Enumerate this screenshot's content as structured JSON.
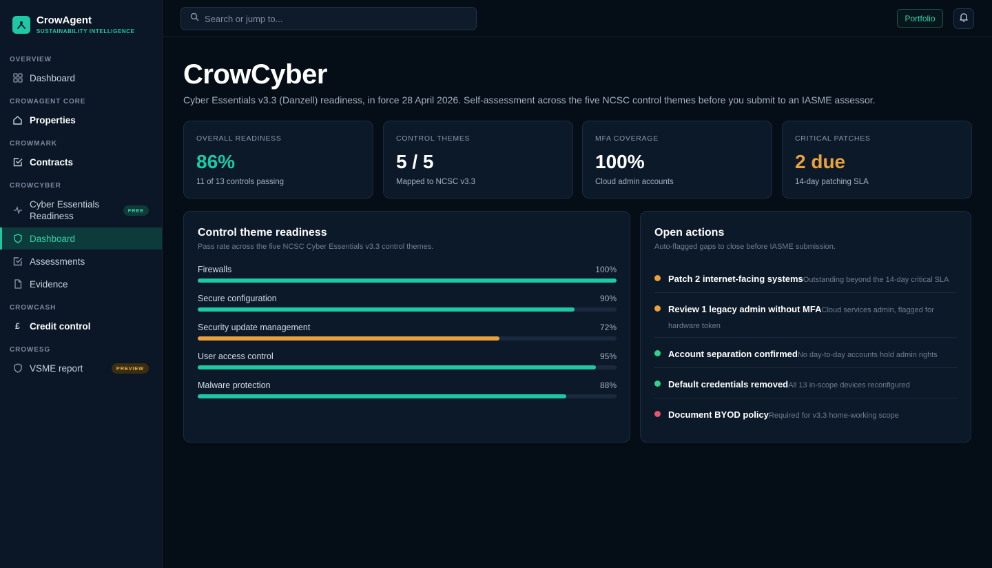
{
  "brand": {
    "name": "CrowAgent",
    "tagline": "SUSTAINABILITY INTELLIGENCE"
  },
  "sidebar": {
    "sections": [
      "OVERVIEW",
      "CROWAGENT CORE",
      "CROWMARK",
      "CROWCYBER",
      "CROWCASH",
      "CROWESG"
    ],
    "items": [
      {
        "label": "Dashboard",
        "icon": "grid-icon"
      },
      {
        "label": "Properties",
        "icon": "home-icon"
      },
      {
        "label": "Contracts",
        "icon": "checkbox-icon"
      },
      {
        "label": "Cyber Essentials Readiness",
        "icon": "sparkle-icon",
        "badge": "FREE"
      },
      {
        "label": "Dashboard",
        "icon": "shield-icon",
        "active": true
      },
      {
        "label": "Assessments",
        "icon": "checkbox-icon"
      },
      {
        "label": "Evidence",
        "icon": "document-icon"
      },
      {
        "label": "Credit control",
        "icon": "pound-icon",
        "glyph": "£"
      },
      {
        "label": "VSME report",
        "icon": "shield-icon",
        "badge": "PREVIEW"
      }
    ]
  },
  "topbar": {
    "search_placeholder": "Search or jump to...",
    "portfolio_label": "Portfolio"
  },
  "page": {
    "title": "CrowCyber",
    "subtitle": "Cyber Essentials v3.3 (Danzell) readiness, in force 28 April 2026. Self-assessment across the five NCSC control themes before you submit to an IASME assessor."
  },
  "kpis": [
    {
      "label": "OVERALL READINESS",
      "value": "86%",
      "sub": "11 of 13 controls passing",
      "color": "#1ec8a5"
    },
    {
      "label": "CONTROL THEMES",
      "value": "5 / 5",
      "sub": "Mapped to NCSC v3.3",
      "color": "#ffffff"
    },
    {
      "label": "MFA COVERAGE",
      "value": "100%",
      "sub": "Cloud admin accounts",
      "color": "#ffffff"
    },
    {
      "label": "CRITICAL PATCHES",
      "value": "2 due",
      "sub": "14-day patching SLA",
      "color": "#e9a23b"
    }
  ],
  "themes_panel": {
    "title": "Control theme readiness",
    "subtitle": "Pass rate across the five NCSC Cyber Essentials v3.3 control themes.",
    "rows": [
      {
        "label": "Firewalls",
        "value": "100%",
        "percent": 100,
        "color": "#1ec8a5"
      },
      {
        "label": "Secure configuration",
        "value": "90%",
        "percent": 90,
        "color": "#1ec8a5"
      },
      {
        "label": "Security update management",
        "value": "72%",
        "percent": 72,
        "color": "#e9a23b"
      },
      {
        "label": "User access control",
        "value": "95%",
        "percent": 95,
        "color": "#1ec8a5"
      },
      {
        "label": "Malware protection",
        "value": "88%",
        "percent": 88,
        "color": "#1ec8a5"
      }
    ]
  },
  "actions_panel": {
    "title": "Open actions",
    "subtitle": "Auto-flagged gaps to close before IASME submission.",
    "items": [
      {
        "title": "Patch 2 internet-facing systems",
        "desc": "Outstanding beyond the 14-day critical SLA",
        "color": "#e9a23b"
      },
      {
        "title": "Review 1 legacy admin without MFA",
        "desc": "Cloud services admin, flagged for hardware token",
        "color": "#e9a23b"
      },
      {
        "title": "Account separation confirmed",
        "desc": "No day-to-day accounts hold admin rights",
        "color": "#2fd38a"
      },
      {
        "title": "Default credentials removed",
        "desc": "All 13 in-scope devices reconfigured",
        "color": "#2fd38a"
      },
      {
        "title": "Document BYOD policy",
        "desc": "Required for v3.3 home-working scope",
        "color": "#e5556b"
      }
    ]
  },
  "colors": {
    "accent": "#1ec8a5",
    "warning": "#e9a23b",
    "danger": "#e5556b",
    "success": "#2fd38a",
    "track": "#1a2a3e"
  }
}
